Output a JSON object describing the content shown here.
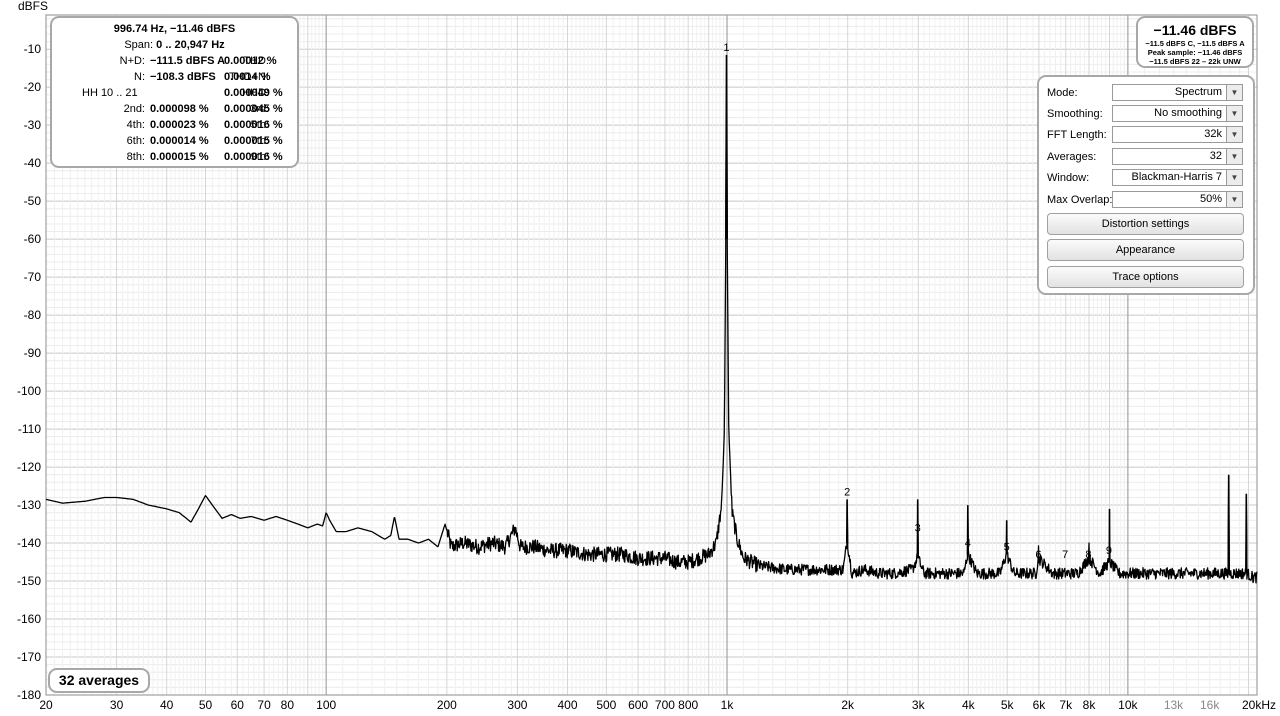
{
  "stats": {
    "peak_readout": "996.74 Hz, −11.46 dBFS",
    "span_label": "Span:",
    "span_value": "0 .. 20,947 Hz",
    "rows": [
      {
        "l1": "N+D:",
        "v1": "−111.5 dBFS A",
        "l2": "THD:",
        "v2": "0.00012 %"
      },
      {
        "l1": "N:",
        "v1": "−108.3 dBFS",
        "l2": "THD+N:",
        "v2": "0.0014 %"
      },
      {
        "l1": "HH 10 .. 21",
        "v1": "",
        "l2": "HHD:",
        "v2": "0.000049 %"
      },
      {
        "l1": "2nd:",
        "v1": "0.000098 %",
        "l2": "3rd:",
        "v2": "0.000045 %"
      },
      {
        "l1": "4th:",
        "v1": "0.000023 %",
        "l2": "5th:",
        "v2": "0.000016 %"
      },
      {
        "l1": "6th:",
        "v1": "0.000014 %",
        "l2": "7th:",
        "v2": "0.000015 %"
      },
      {
        "l1": "8th:",
        "v1": "0.000015 %",
        "l2": "9th:",
        "v2": "0.000016 %"
      }
    ]
  },
  "level": {
    "main": "−11.46 dBFS",
    "line1": "−11.5 dBFS C, −11.5 dBFS A",
    "line2": "Peak sample: −11.46 dBFS",
    "line3": "−11.5 dBFS 22 – 22k UNW"
  },
  "controls": {
    "mode_label": "Mode:",
    "mode_value": "Spectrum",
    "smoothing_label": "Smoothing:",
    "smoothing_value": "No  smoothing",
    "fft_label": "FFT Length:",
    "fft_value": "32k",
    "averages_label": "Averages:",
    "averages_value": "32",
    "window_label": "Window:",
    "window_value": "Blackman-Harris 7",
    "overlap_label": "Max Overlap:",
    "overlap_value": "50%",
    "distortion_button": "Distortion settings",
    "appearance_button": "Appearance",
    "trace_button": "Trace options"
  },
  "badge": {
    "averages_text": "32 averages"
  },
  "colors": {
    "trace": "#000000",
    "grid": "#d6d6d6",
    "major_grid": "#b0b0b0",
    "panel_border": "#a8a8a8"
  },
  "chart_data": {
    "type": "line",
    "title": "",
    "ylabel": "dBFS",
    "xlabel": "",
    "x_scale": "log",
    "xlim": [
      20,
      21000
    ],
    "ylim": [
      -180,
      -1
    ],
    "y_ticks": [
      -10,
      -20,
      -30,
      -40,
      -50,
      -60,
      -70,
      -80,
      -90,
      -100,
      -110,
      -120,
      -130,
      -140,
      -150,
      -160,
      -170,
      -180
    ],
    "x_ticks": [
      {
        "v": 20,
        "t": "20"
      },
      {
        "v": 30,
        "t": "30"
      },
      {
        "v": 40,
        "t": "40"
      },
      {
        "v": 50,
        "t": "50"
      },
      {
        "v": 60,
        "t": "60"
      },
      {
        "v": 70,
        "t": "70"
      },
      {
        "v": 80,
        "t": "80"
      },
      {
        "v": 100,
        "t": "100"
      },
      {
        "v": 200,
        "t": "200"
      },
      {
        "v": 300,
        "t": "300"
      },
      {
        "v": 400,
        "t": "400"
      },
      {
        "v": 500,
        "t": "500"
      },
      {
        "v": 600,
        "t": "600"
      },
      {
        "v": 700,
        "t": "700"
      },
      {
        "v": 800,
        "t": "800"
      },
      {
        "v": 1000,
        "t": "1k"
      },
      {
        "v": 2000,
        "t": "2k"
      },
      {
        "v": 3000,
        "t": "3k"
      },
      {
        "v": 4000,
        "t": "4k"
      },
      {
        "v": 5000,
        "t": "5k"
      },
      {
        "v": 6000,
        "t": "6k"
      },
      {
        "v": 7000,
        "t": "7k"
      },
      {
        "v": 8000,
        "t": "8k"
      },
      {
        "v": 10000,
        "t": "10k"
      },
      {
        "v": 13000,
        "t": "13k",
        "minor": true
      },
      {
        "v": 16000,
        "t": "16k",
        "minor": true
      },
      {
        "v": 20000,
        "t": "20kHz"
      }
    ],
    "harmonic_labels": [
      {
        "n": "1",
        "f": 997,
        "db": -11.5
      },
      {
        "n": "2",
        "f": 1994,
        "db": -128.5
      },
      {
        "n": "3",
        "f": 2991,
        "db": -138
      },
      {
        "n": "4",
        "f": 3988,
        "db": -142
      },
      {
        "n": "5",
        "f": 4985,
        "db": -143
      },
      {
        "n": "6",
        "f": 5982,
        "db": -145
      },
      {
        "n": "7",
        "f": 6979,
        "db": -145
      },
      {
        "n": "8",
        "f": 7976,
        "db": -145
      },
      {
        "n": "9",
        "f": 8973,
        "db": -144
      }
    ],
    "series": [
      {
        "points": [
          [
            20,
            -128.5
          ],
          [
            22,
            -129.5
          ],
          [
            25,
            -129
          ],
          [
            28,
            -128
          ],
          [
            30,
            -128
          ],
          [
            33,
            -128.5
          ],
          [
            36,
            -130
          ],
          [
            40,
            -131
          ],
          [
            43,
            -132
          ],
          [
            46,
            -134.5
          ],
          [
            48,
            -131
          ],
          [
            50,
            -127.5
          ],
          [
            52,
            -130
          ],
          [
            55,
            -133.5
          ],
          [
            58,
            -132.5
          ],
          [
            61,
            -133.5
          ],
          [
            65,
            -133
          ],
          [
            70,
            -134
          ],
          [
            75,
            -133
          ],
          [
            80,
            -134
          ],
          [
            85,
            -135
          ],
          [
            90,
            -136
          ],
          [
            95,
            -135
          ],
          [
            98,
            -135.5
          ],
          [
            100,
            -132
          ],
          [
            102,
            -134
          ],
          [
            106,
            -137
          ],
          [
            112,
            -137
          ],
          [
            120,
            -136
          ],
          [
            130,
            -137
          ],
          [
            140,
            -139
          ],
          [
            145,
            -138
          ],
          [
            148,
            -133
          ],
          [
            152,
            -139
          ],
          [
            160,
            -139
          ],
          [
            170,
            -140
          ],
          [
            180,
            -139
          ],
          [
            190,
            -141
          ],
          [
            198,
            -135
          ],
          [
            205,
            -141
          ],
          [
            220,
            -140
          ],
          [
            240,
            -141
          ],
          [
            260,
            -140
          ],
          [
            280,
            -141
          ],
          [
            296,
            -136
          ],
          [
            305,
            -141
          ],
          [
            330,
            -141
          ],
          [
            360,
            -142
          ],
          [
            400,
            -142
          ],
          [
            450,
            -143
          ],
          [
            500,
            -143
          ],
          [
            550,
            -143
          ],
          [
            600,
            -144
          ],
          [
            650,
            -144
          ],
          [
            700,
            -144
          ],
          [
            750,
            -145
          ],
          [
            800,
            -145
          ],
          [
            850,
            -144
          ],
          [
            900,
            -143
          ],
          [
            940,
            -140
          ],
          [
            970,
            -130
          ],
          [
            985,
            -110
          ],
          [
            993,
            -60
          ],
          [
            997,
            -11.5
          ],
          [
            1001,
            -60
          ],
          [
            1010,
            -110
          ],
          [
            1030,
            -132
          ],
          [
            1060,
            -139
          ],
          [
            1100,
            -144
          ],
          [
            1200,
            -146
          ],
          [
            1400,
            -147
          ],
          [
            1600,
            -147
          ],
          [
            1800,
            -147
          ],
          [
            1950,
            -147
          ],
          [
            1990,
            -140
          ],
          [
            1994,
            -128.5
          ],
          [
            1998,
            -140
          ],
          [
            2050,
            -148
          ],
          [
            2200,
            -147
          ],
          [
            2400,
            -148
          ],
          [
            2600,
            -148
          ],
          [
            2900,
            -147
          ],
          [
            2985,
            -144
          ],
          [
            2991,
            -128.5
          ],
          [
            2997,
            -144
          ],
          [
            3100,
            -148
          ],
          [
            3500,
            -148
          ],
          [
            3900,
            -148
          ],
          [
            3982,
            -143
          ],
          [
            3988,
            -130
          ],
          [
            3994,
            -143
          ],
          [
            4200,
            -148
          ],
          [
            4800,
            -148
          ],
          [
            4978,
            -143
          ],
          [
            4985,
            -134
          ],
          [
            4992,
            -143
          ],
          [
            5200,
            -148
          ],
          [
            5900,
            -148
          ],
          [
            5975,
            -144
          ],
          [
            5982,
            -138
          ],
          [
            5989,
            -144
          ],
          [
            6500,
            -148
          ],
          [
            7000,
            -148
          ],
          [
            7500,
            -148
          ],
          [
            7990,
            -144
          ],
          [
            8000,
            -139
          ],
          [
            8010,
            -144
          ],
          [
            8500,
            -148
          ],
          [
            8990,
            -145
          ],
          [
            9000,
            -131
          ],
          [
            9010,
            -145
          ],
          [
            9500,
            -148
          ],
          [
            10000,
            -148
          ],
          [
            11000,
            -148
          ],
          [
            12000,
            -148
          ],
          [
            13000,
            -148
          ],
          [
            14000,
            -148
          ],
          [
            15000,
            -148
          ],
          [
            16000,
            -148
          ],
          [
            17000,
            -148
          ],
          [
            17800,
            -148
          ],
          [
            17850,
            -122
          ],
          [
            17900,
            -148
          ],
          [
            19000,
            -148
          ],
          [
            19700,
            -148
          ],
          [
            19750,
            -127
          ],
          [
            19800,
            -148
          ],
          [
            20500,
            -149
          ],
          [
            21000,
            -149
          ]
        ]
      }
    ]
  }
}
